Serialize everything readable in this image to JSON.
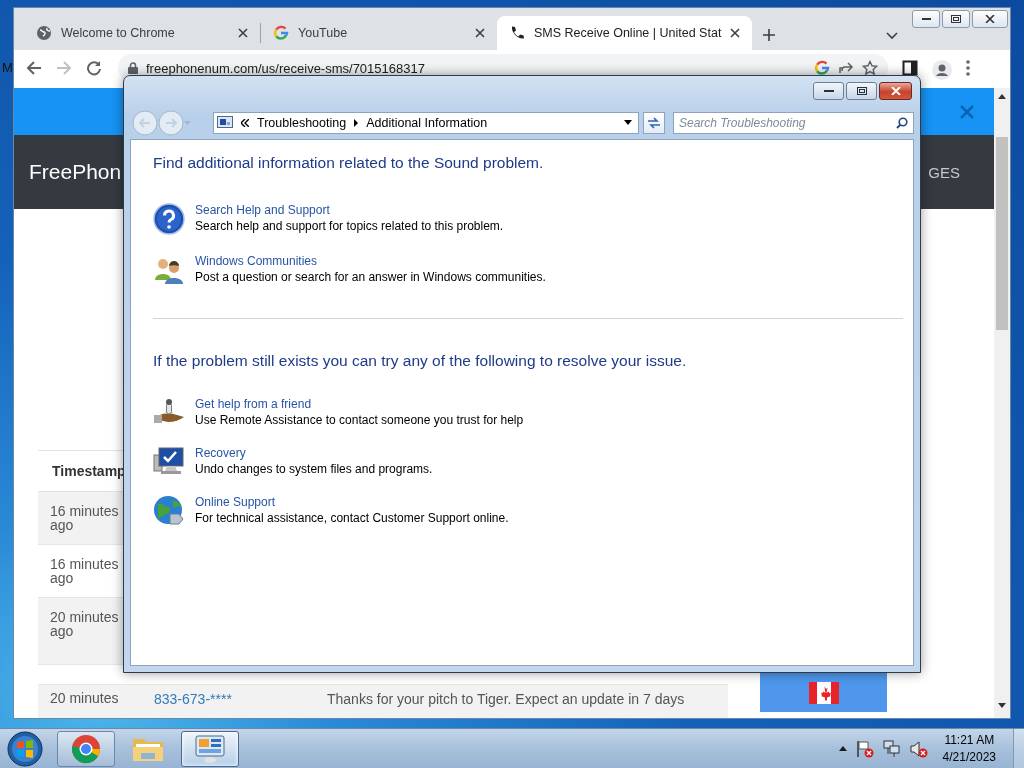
{
  "desktop": {
    "icon_label": "M"
  },
  "browser": {
    "tabs": [
      {
        "label": "Welcome to Chrome",
        "kind": "globe",
        "selected": false
      },
      {
        "label": "YouTube",
        "kind": "google",
        "selected": false
      },
      {
        "label": "SMS Receive Online | United Stat",
        "kind": "phone",
        "selected": true
      }
    ],
    "nav": {
      "forward_disabled": true
    },
    "address": "freephonenum.com/us/receive-sms/7015168317",
    "page": {
      "brand": "FreePhon",
      "nav_item": "GES",
      "table": {
        "header": "Timestamp",
        "rows": [
          {
            "timestamp": "16 minutes ago",
            "shaded": true
          },
          {
            "timestamp": "16 minutes ago",
            "shaded": false
          },
          {
            "timestamp": "20 minutes ago",
            "shaded": true
          },
          {
            "shaded": false
          },
          {
            "timestamp": "20 minutes",
            "number": "833-673-****",
            "message": "Thanks for your pitch to Tiger. Expect an update in 7 days",
            "shaded": true
          }
        ]
      }
    }
  },
  "dialog": {
    "breadcrumb": [
      "Troubleshooting",
      "Additional Information"
    ],
    "search_placeholder": "Search Troubleshooting",
    "sections": [
      {
        "heading": "Find additional information related to the Sound problem.",
        "items": [
          {
            "kind": "help",
            "title": "Search Help and Support",
            "description": "Search help and support for topics related to this problem."
          },
          {
            "kind": "community",
            "title": "Windows Communities",
            "description": "Post a question or search for an answer in Windows communities."
          }
        ]
      },
      {
        "heading": "If the problem still exists you can try any of the following to resolve your issue.",
        "items": [
          {
            "kind": "friend",
            "title": "Get help from a friend",
            "description": "Use Remote Assistance to contact someone you trust for help"
          },
          {
            "kind": "recovery",
            "title": "Recovery",
            "description": "Undo changes to system files and programs."
          },
          {
            "kind": "online",
            "title": "Online Support",
            "description": "For technical assistance, contact Customer Support online."
          }
        ]
      }
    ]
  },
  "taskbar": {
    "buttons": [
      {
        "kind": "chrome",
        "running": true,
        "selected": false
      },
      {
        "kind": "folder",
        "running": false,
        "selected": false
      },
      {
        "kind": "control-panel",
        "running": true,
        "selected": true
      }
    ],
    "time": "11:21 AM",
    "date": "4/21/2023"
  }
}
